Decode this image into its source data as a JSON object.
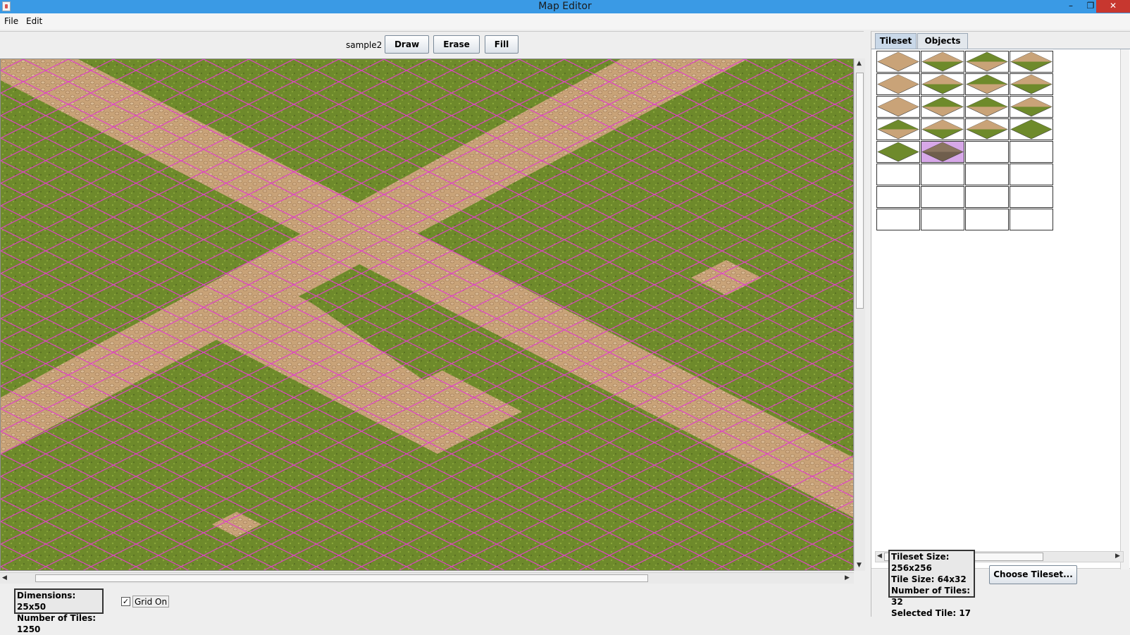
{
  "window": {
    "title": "Map Editor",
    "minimize_glyph": "–",
    "restore_glyph": "❐",
    "close_glyph": "✕"
  },
  "menu": {
    "file": "File",
    "edit": "Edit"
  },
  "toolbar": {
    "map_name": "sample2",
    "draw_label": "Draw",
    "erase_label": "Erase",
    "fill_label": "Fill"
  },
  "map": {
    "colors": {
      "grass": "#6e8a2b",
      "grass_dark": "#5e7a22",
      "path": "#c9a378",
      "path_dark": "#a8815a",
      "grid": "#e040c8"
    }
  },
  "status": {
    "dimensions": "Dimensions: 25x50",
    "num_tiles": "Number of Tiles: 1250",
    "grid_checked": "✓",
    "grid_label": "Grid On"
  },
  "tabs": {
    "tileset": "Tileset",
    "objects": "Objects"
  },
  "palette": {
    "tiles": [
      "path",
      "path-grass",
      "grass-path",
      "path-grass",
      "path",
      "path-grass",
      "grass-path",
      "path-grass",
      "path",
      "grass-path",
      "grass-path",
      "path-grass",
      "grass-path",
      "path-grass",
      "path-grass",
      "grass",
      "grass",
      "dirt-selected"
    ],
    "selected_color": "#d7a8e8"
  },
  "tileset_info": {
    "size": "Tileset Size: 256x256",
    "tile_size": "Tile Size: 64x32",
    "num_tiles": "Number of Tiles: 32",
    "selected": "Selected Tile: 17"
  },
  "choose_tileset": "Choose Tileset..."
}
